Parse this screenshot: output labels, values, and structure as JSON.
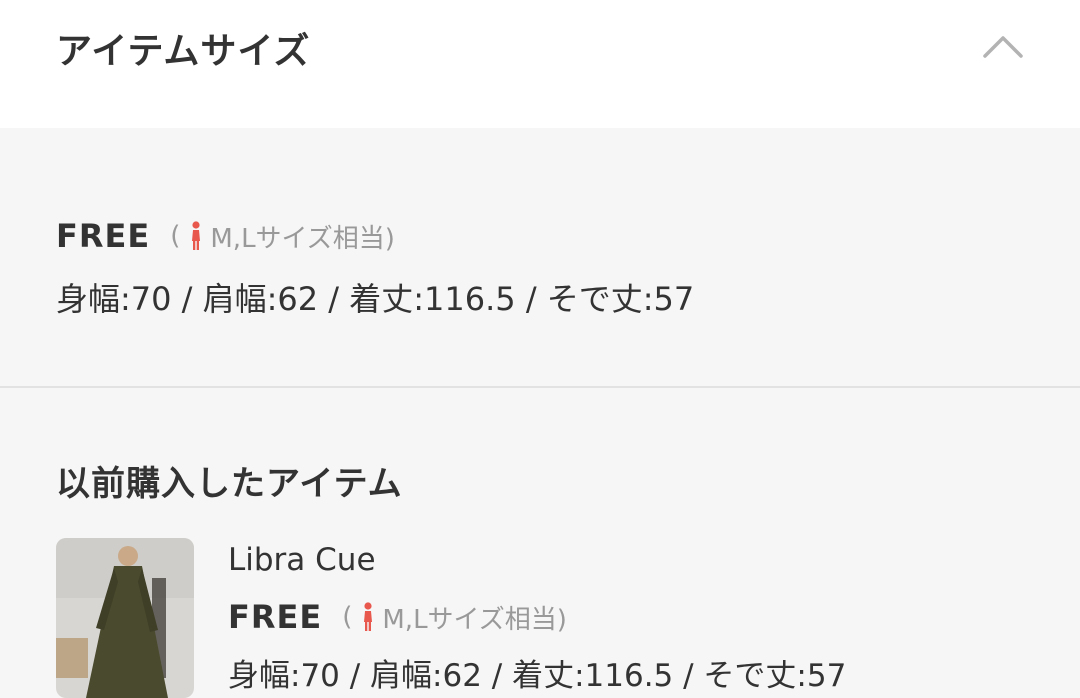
{
  "header": {
    "title": "アイテムサイズ",
    "toggle_icon": "chevron-up-icon"
  },
  "size": {
    "label": "FREE",
    "open_paren": "(",
    "equivalent": "M,Lサイズ相当)",
    "icon": "female-figure-icon",
    "measurements": "身幅:70 / 肩幅:62 / 着丈:116.5 / そで丈:57"
  },
  "previous": {
    "title": "以前購入したアイテム",
    "items": [
      {
        "brand": "Libra Cue",
        "size_label": "FREE",
        "open_paren": "(",
        "equivalent": "M,Lサイズ相当)",
        "measurements": "身幅:70 / 肩幅:62 / 着丈:116.5 / そで丈:57"
      }
    ]
  },
  "colors": {
    "accent": "#e8584d",
    "muted_text": "#999999",
    "text": "#333333",
    "background": "#f6f6f6"
  }
}
